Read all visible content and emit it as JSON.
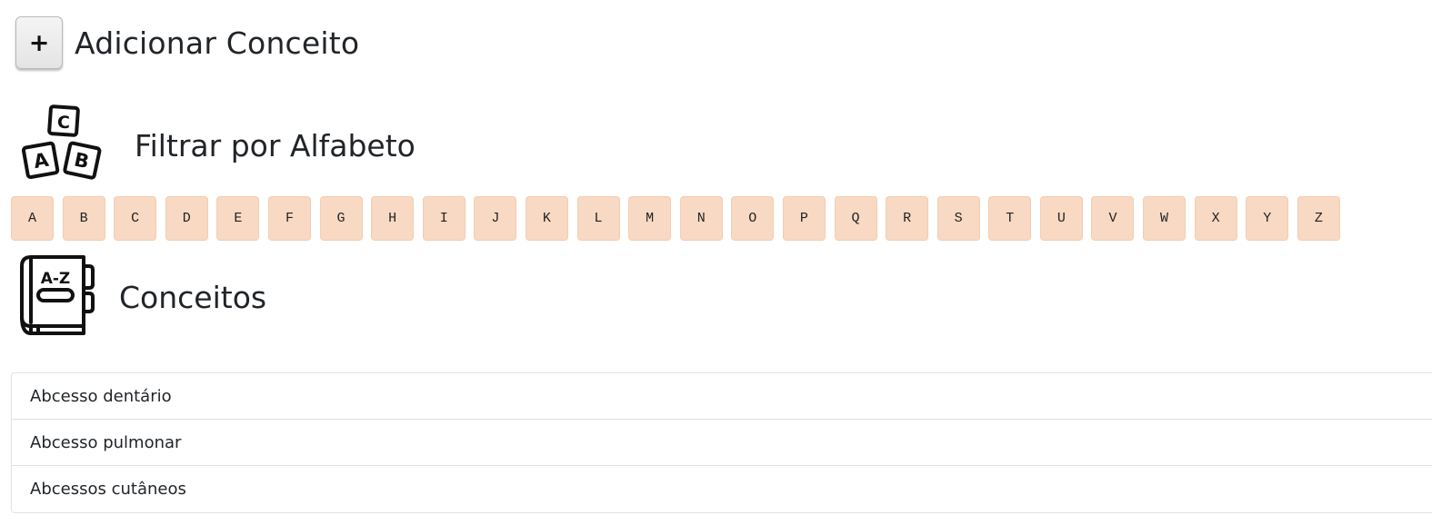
{
  "add_concept": {
    "button_symbol": "+",
    "title": "Adicionar Conceito"
  },
  "filter": {
    "icon": "abc-blocks-icon",
    "title": "Filtrar por Alfabeto",
    "letters": [
      "A",
      "B",
      "C",
      "D",
      "E",
      "F",
      "G",
      "H",
      "I",
      "J",
      "K",
      "L",
      "M",
      "N",
      "O",
      "P",
      "Q",
      "R",
      "S",
      "T",
      "U",
      "V",
      "W",
      "X",
      "Y",
      "Z"
    ],
    "button_color": "#f8d9c3"
  },
  "concepts": {
    "icon": "a-z-book-icon",
    "title": "Conceitos",
    "items": [
      "Abcesso dentário",
      "Abcesso pulmonar",
      "Abcessos cutâneos"
    ]
  }
}
